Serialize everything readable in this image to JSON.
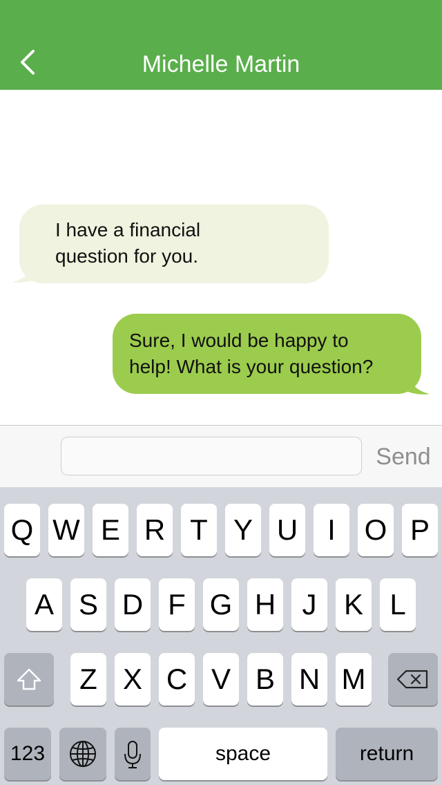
{
  "nav": {
    "title": "Michelle Martin",
    "back_icon": "chevron-left-icon",
    "background": "#5aae4b"
  },
  "messages": [
    {
      "direction": "incoming",
      "lines": [
        "I have a financial",
        "question for you."
      ],
      "color": "#eff3df"
    },
    {
      "direction": "outgoing",
      "lines": [
        "Sure, I would be happy to",
        "help!  What is your question?"
      ],
      "color": "#9ccc4d"
    }
  ],
  "composer": {
    "input_value": "",
    "send_label": "Send"
  },
  "keyboard": {
    "row1": [
      "Q",
      "W",
      "E",
      "R",
      "T",
      "Y",
      "U",
      "I",
      "O",
      "P"
    ],
    "row2": [
      "A",
      "S",
      "D",
      "F",
      "G",
      "H",
      "J",
      "K",
      "L"
    ],
    "row3": [
      "Z",
      "X",
      "C",
      "V",
      "B",
      "N",
      "M"
    ],
    "numbers_label": "123",
    "space_label": "space",
    "return_label": "return",
    "icons": {
      "shift": "shift-icon",
      "delete": "backspace-icon",
      "globe": "globe-icon",
      "mic": "microphone-icon"
    }
  }
}
